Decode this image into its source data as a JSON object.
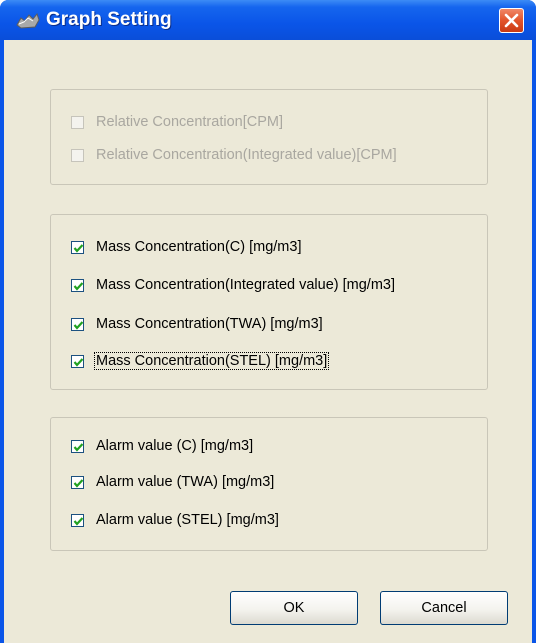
{
  "window": {
    "title": "Graph Setting"
  },
  "groups": [
    {
      "items": [
        {
          "label": "Relative Concentration[CPM]",
          "checked": false,
          "disabled": true
        },
        {
          "label": "Relative Concentration(Integrated value)[CPM]",
          "checked": false,
          "disabled": true
        }
      ]
    },
    {
      "items": [
        {
          "label": "Mass Concentration(C) [mg/m3]",
          "checked": true,
          "disabled": false
        },
        {
          "label": "Mass Concentration(Integrated value) [mg/m3]",
          "checked": true,
          "disabled": false
        },
        {
          "label": "Mass Concentration(TWA) [mg/m3]",
          "checked": true,
          "disabled": false
        },
        {
          "label": "Mass Concentration(STEL) [mg/m3]",
          "checked": true,
          "disabled": false,
          "focused": true
        }
      ]
    },
    {
      "items": [
        {
          "label": "Alarm value (C) [mg/m3]",
          "checked": true,
          "disabled": false
        },
        {
          "label": "Alarm value (TWA) [mg/m3]",
          "checked": true,
          "disabled": false
        },
        {
          "label": "Alarm value (STEL) [mg/m3]",
          "checked": true,
          "disabled": false
        }
      ]
    }
  ],
  "buttons": {
    "ok": "OK",
    "cancel": "Cancel"
  },
  "colors": {
    "titlebar": "#0a55e8",
    "client": "#ece9d8",
    "close": "#e2542b"
  },
  "icons": {
    "title": "graph-app-icon",
    "close": "close-icon",
    "check": "checkmark-icon"
  }
}
